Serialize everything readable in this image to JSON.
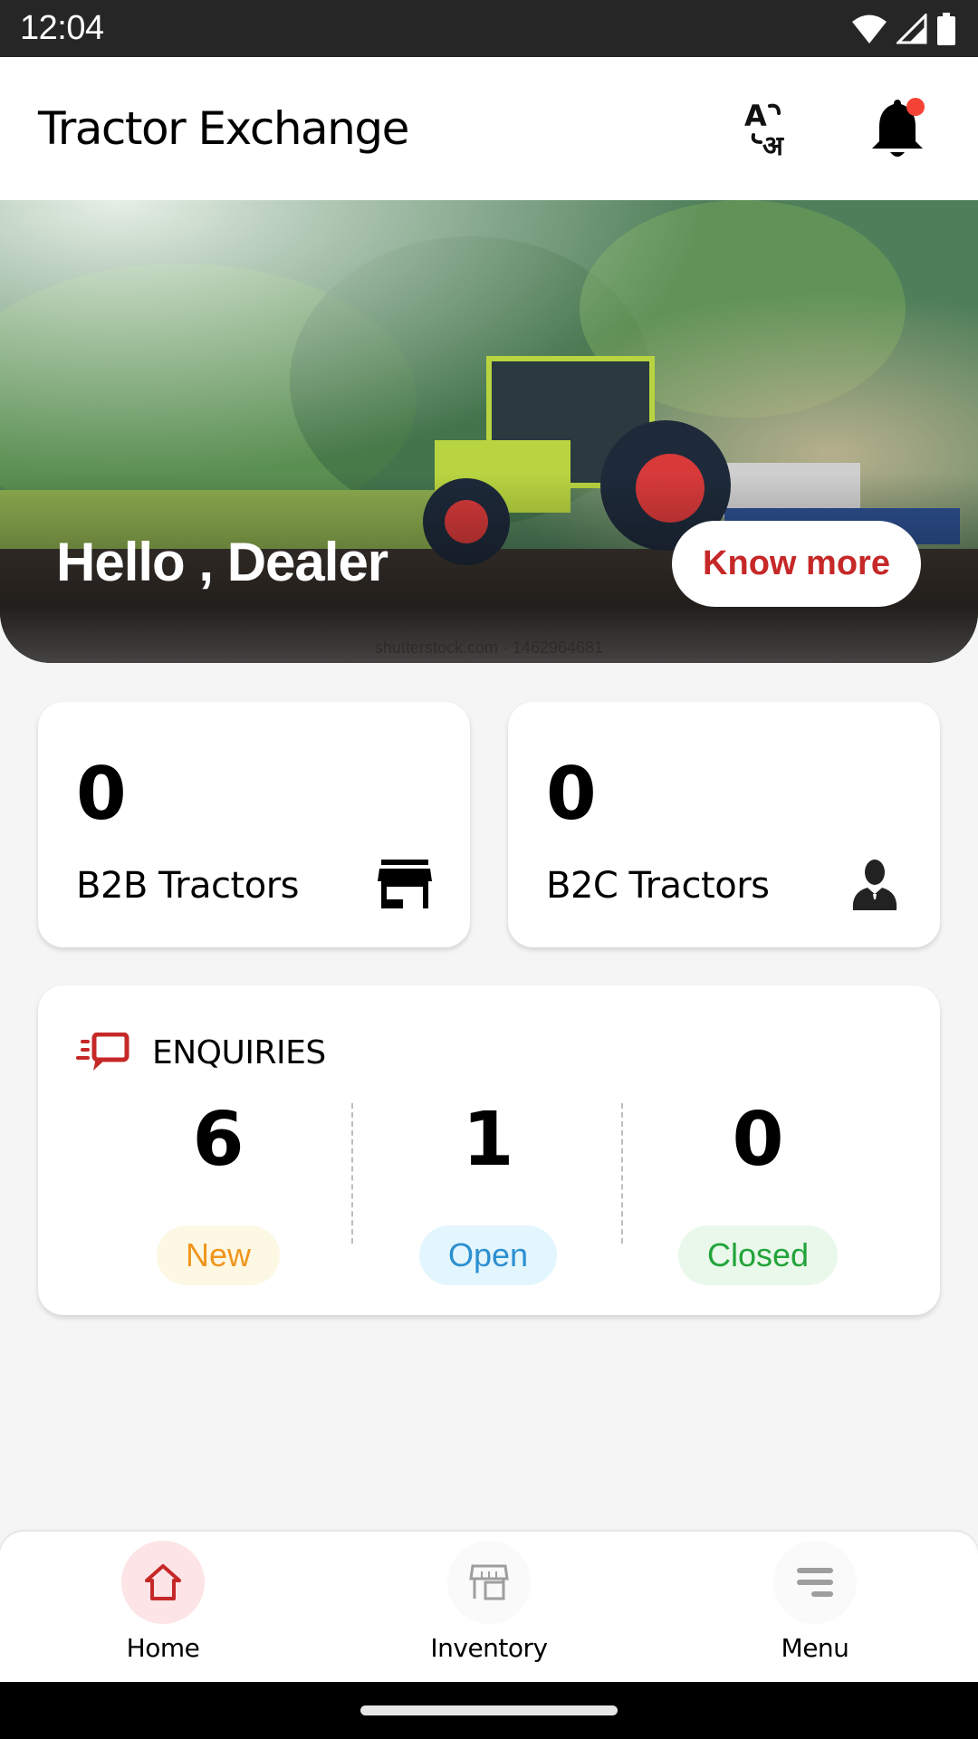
{
  "status_bar": {
    "time": "12:04",
    "icons": [
      "wifi-icon",
      "signal-icon",
      "battery-icon"
    ]
  },
  "app_bar": {
    "title": "Tractor Exchange",
    "actions": [
      {
        "name": "language-translate-icon",
        "label": "Language"
      },
      {
        "name": "notification-bell-icon",
        "label": "Notifications",
        "has_badge": true
      }
    ]
  },
  "banner": {
    "greeting": "Hello , Dealer",
    "button_label": "Know more",
    "watermark": "shutterstock.com · 1462964681"
  },
  "stats": [
    {
      "value": "0",
      "label": "B2B Tractors",
      "icon": "store-icon"
    },
    {
      "value": "0",
      "label": "B2C Tractors",
      "icon": "person-icon"
    }
  ],
  "enquiries": {
    "title": "ENQUIRIES",
    "icon": "chat-bubble-icon",
    "items": [
      {
        "count": "6",
        "status": "New",
        "text_color": "#f0961e",
        "bg_color": "#fdf8e4"
      },
      {
        "count": "1",
        "status": "Open",
        "text_color": "#2b8fd0",
        "bg_color": "#e3f5fd"
      },
      {
        "count": "0",
        "status": "Closed",
        "text_color": "#22a33a",
        "bg_color": "#e9f8ea"
      }
    ]
  },
  "bottom_nav": {
    "items": [
      {
        "label": "Home",
        "icon": "home-icon",
        "active": true
      },
      {
        "label": "Inventory",
        "icon": "inventory-store-icon",
        "active": false
      },
      {
        "label": "Menu",
        "icon": "menu-icon",
        "active": false
      }
    ]
  },
  "colors": {
    "accent": "#c62828",
    "notification_dot": "#f44336",
    "active_nav_bg": "#fde4e6",
    "page_bg": "#f5f5f5"
  }
}
